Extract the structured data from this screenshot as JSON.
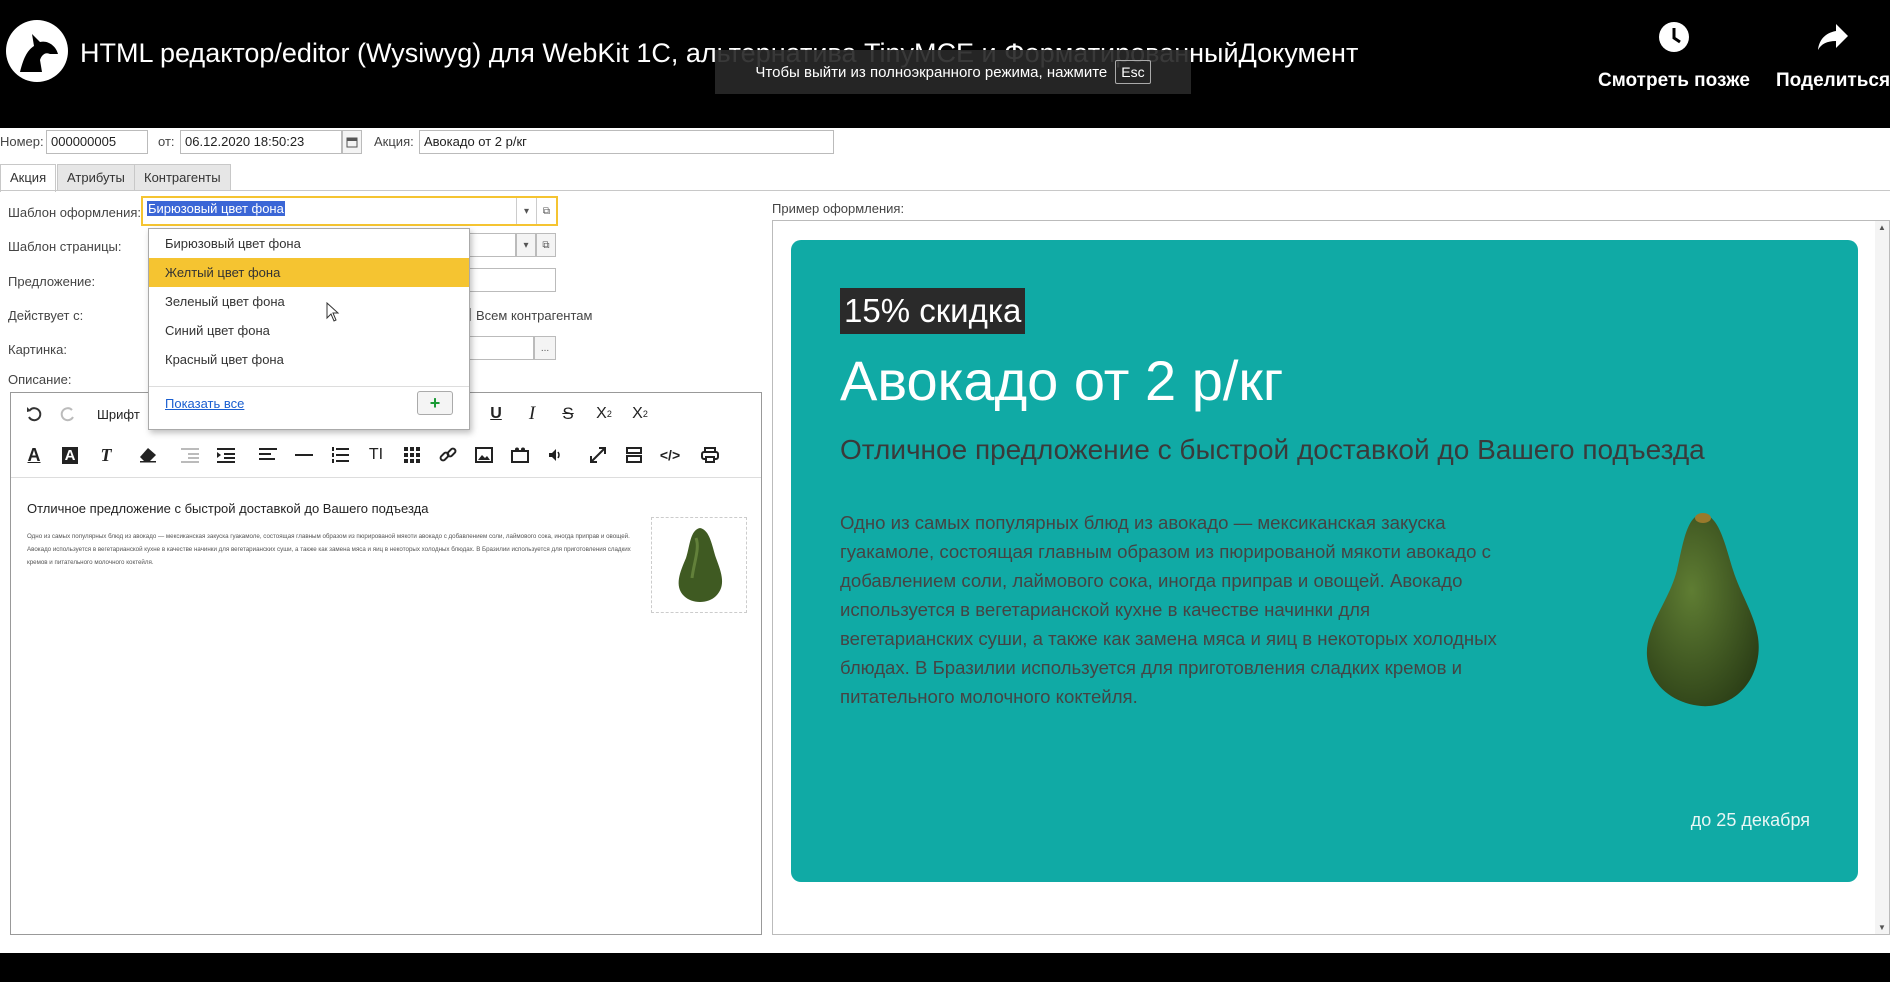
{
  "video": {
    "title": "HTML редактор/editor (Wysiwyg) для WebKit 1С, альтернатива TinyMCE и ФорматированныйДокумент",
    "esc_hint": "Чтобы выйти из полноэкранного режима, нажмите",
    "esc_key": "Esc",
    "watch_later": "Смотреть позже",
    "share": "Поделиться"
  },
  "form": {
    "number_label": "Номер:",
    "number_value": "000000005",
    "from_label": "от:",
    "date_value": "06.12.2020 18:50:23",
    "promo_label": "Акция:",
    "promo_value": "Авокадо от 2 р/кг"
  },
  "tabs": [
    "Акция",
    "Атрибуты",
    "Контрагенты"
  ],
  "fields": {
    "template_label": "Шаблон оформления:",
    "template_value": "Бирюзовый цвет фона",
    "page_template_label": "Шаблон страницы:",
    "offer_label": "Предложение:",
    "valid_from_label": "Действует с:",
    "all_contractors": "Всем контрагентам",
    "picture_label": "Картинка:",
    "picture_btn": "...",
    "description_label": "Описание:",
    "preview_label": "Пример оформления:"
  },
  "dropdown": {
    "items": [
      "Бирюзовый цвет фона",
      "Желтый цвет фона",
      "Зеленый цвет фона",
      "Синий цвет фона",
      "Красный цвет фона"
    ],
    "highlighted": 1,
    "show_all": "Показать все",
    "add": "+"
  },
  "editor": {
    "font_btn": "Шрифт",
    "heading": "Отличное предложение с быстрой доставкой до Вашего подъезда",
    "body": "Одно из самых популярных блюд из авокадо — мексиканская закуска гуакамоле, состоящая главным образом из пюрированой мякоти авокадо с добавлением соли, лаймового сока, иногда приправ и овощей. Авокадо используется в вегетарианской кухне в качестве начинки для вегетарианских суши, а также как замена мяса и яиц в некоторых холодных блюдах. В Бразилии используется для приготовления сладких кремов и питательного молочного коктейля."
  },
  "preview": {
    "badge": "15% скидка",
    "title": "Авокадо от 2 р/кг",
    "subtitle": "Отличное предложение с быстрой доставкой до Вашего подъезда",
    "lines": [
      "Одно из самых популярных блюд из авокадо — мексиканская закуска",
      "гуакамоле, состоящая главным образом из пюрированой мякоти авокадо с",
      "добавлением соли, лаймового сока, иногда приправ и овощей. Авокадо",
      "используется в вегетарианской кухне в качестве начинки для",
      "вегетарианских суши, а также как замена мяса и яиц в некоторых холодных",
      "блюдах. В Бразилии используется для приготовления сладких кремов и",
      "питательного молочного коктейля."
    ],
    "footer": "до 25 декабря"
  },
  "colors": {
    "card_bg": "#10aaa5",
    "highlight": "#f5c431",
    "selection": "#3b66d6"
  }
}
